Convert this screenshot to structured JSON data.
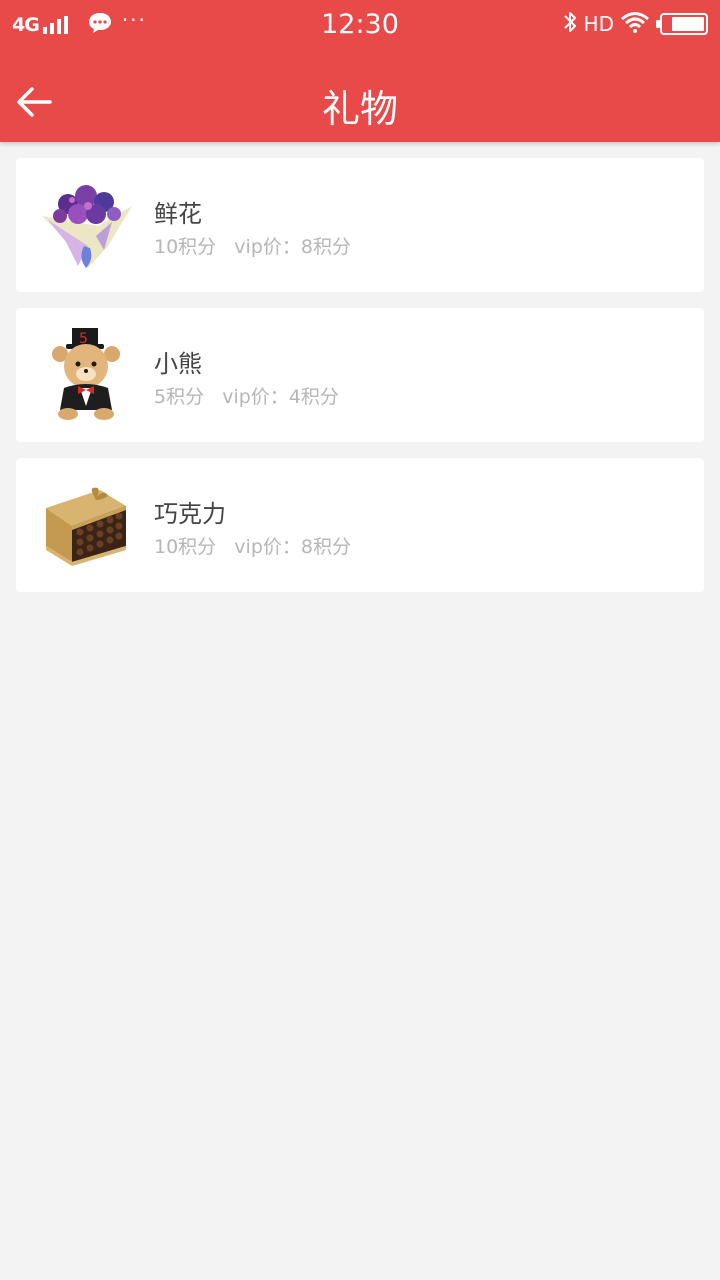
{
  "status_bar": {
    "network": "4G",
    "time": "12:30",
    "hd": "HD",
    "more": "···"
  },
  "header": {
    "title": "礼物"
  },
  "gifts": [
    {
      "name": "鲜花",
      "price": "10积分   vip价：8积分",
      "icon": "flower-bouquet"
    },
    {
      "name": "小熊",
      "price": "5积分   vip价：4积分",
      "icon": "teddy-bear"
    },
    {
      "name": "巧克力",
      "price": "10积分   vip价：8积分",
      "icon": "chocolate-box"
    }
  ],
  "colors": {
    "accent": "#e84a4a",
    "background": "#f3f3f3",
    "card": "#ffffff",
    "title_text": "#444444",
    "sub_text": "#b6b6b6"
  }
}
